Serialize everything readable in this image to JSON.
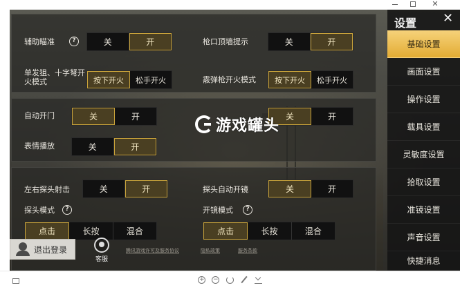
{
  "sidebar": {
    "title": "设置",
    "items": [
      {
        "label": "基础设置",
        "active": true
      },
      {
        "label": "画面设置"
      },
      {
        "label": "操作设置"
      },
      {
        "label": "载具设置"
      },
      {
        "label": "灵敏度设置"
      },
      {
        "label": "拾取设置"
      },
      {
        "label": "准镜设置"
      },
      {
        "label": "声音设置"
      },
      {
        "label": "快捷消息"
      }
    ]
  },
  "settings": {
    "aim_assist": {
      "label": "辅助瞄准",
      "options": [
        "关",
        "开"
      ],
      "selected": "开"
    },
    "muzzle_wall": {
      "label": "枪口顶墙提示",
      "options": [
        "关",
        "开"
      ],
      "selected": "开"
    },
    "sniper_fire": {
      "label": "单发狙、十字弩开火模式",
      "options": [
        "按下开火",
        "松手开火"
      ],
      "selected": "按下开火"
    },
    "shotgun_fire": {
      "label": "霰弹枪开火模式",
      "options": [
        "按下开火",
        "松手开火"
      ],
      "selected": "按下开火"
    },
    "auto_door": {
      "label": "自动开门",
      "options": [
        "关",
        "开"
      ],
      "selected": "关"
    },
    "right_toggle": {
      "label": "",
      "options": [
        "关",
        "开"
      ],
      "selected": "关"
    },
    "emote": {
      "label": "表情播放",
      "options": [
        "关",
        "开"
      ],
      "selected": "开"
    },
    "lean_fire": {
      "label": "左右探头射击",
      "options": [
        "关",
        "开"
      ],
      "selected": "开"
    },
    "lean_scope": {
      "label": "探头自动开镜",
      "options": [
        "关",
        "开"
      ],
      "selected": "关"
    },
    "lean_mode": {
      "label": "探头模式",
      "options": [
        "点击",
        "长按",
        "混合"
      ],
      "selected": "点击"
    },
    "scope_mode": {
      "label": "开镜模式",
      "options": [
        "点击",
        "长按",
        "混合"
      ],
      "selected": "点击"
    }
  },
  "bottom": {
    "logout_label": "退出登录",
    "service_label": "客服",
    "links": [
      "腾讯游戏许可及服务协议",
      "隐私政策",
      "服务条款"
    ]
  },
  "watermark": {
    "text": "游戏罐头"
  },
  "icons": {
    "help": "question-circle-icon",
    "close": "close-x-icon",
    "avatar": "user-silhouette-icon",
    "service": "headset-icon"
  },
  "colors": {
    "accent": "#e3ac34",
    "selected_border": "#c9a33a"
  }
}
